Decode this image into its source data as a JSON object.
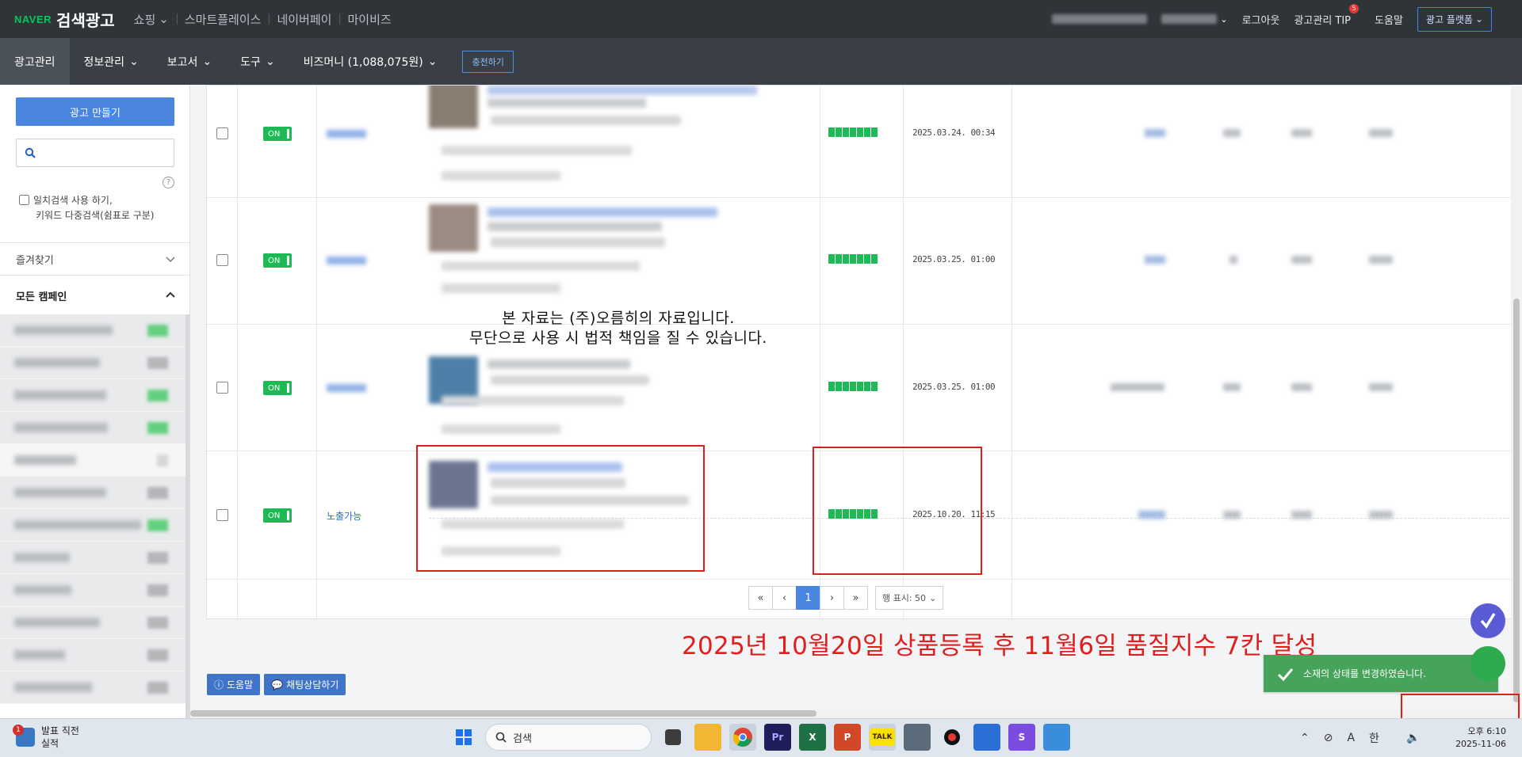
{
  "topbar": {
    "brand_naver": "NAVER",
    "brand_title": "검색광고",
    "nav": [
      "쇼핑",
      "스마트플레이스",
      "네이버페이",
      "마이비즈"
    ],
    "logout": "로그아웃",
    "tip": "광고관리 TIP",
    "tip_badge": "5",
    "help": "도움말",
    "platform": "광고 플랫폼"
  },
  "subbar": {
    "items": [
      "광고관리",
      "정보관리",
      "보고서",
      "도구",
      "비즈머니 (1,088,075원)"
    ],
    "charge": "충전하기"
  },
  "sidebar": {
    "create_button": "광고 만들기",
    "search_placeholder": "",
    "help_mark": "?",
    "exact_line1": "일치검색 사용 하기,",
    "exact_line2": "키워드 다중검색(쉼표로 구분)",
    "favorites": "즐겨찾기",
    "all_campaigns": "모든 캠페인"
  },
  "table": {
    "toggle_label": "ON",
    "rows": [
      {
        "date": "2025.03.24. 00:34",
        "status": ""
      },
      {
        "date": "2025.03.25. 01:00",
        "status": ""
      },
      {
        "date": "2025.03.25. 01:00",
        "status": ""
      },
      {
        "date": "2025.10.20. 11:15",
        "status": "노출가능"
      }
    ],
    "quality_bars_filled": 7
  },
  "watermark": {
    "line1": "본 자료는 (주)오름히의 자료입니다.",
    "line2": "무단으로 사용 시 법적 책임을 질 수 있습니다."
  },
  "pager": {
    "first": "«",
    "prev": "‹",
    "current": "1",
    "next": "›",
    "last": "»",
    "rows_label": "행 표시: 50"
  },
  "caption": "2025년 10월20일 상품등록 후 11월6일 품질지수 7칸 달성",
  "bottom_buttons": {
    "help": "도움말",
    "chat": "채팅상담하기"
  },
  "toast": {
    "message": "소재의 상태를 변경하였습니다."
  },
  "taskbar": {
    "weather_title": "발표 직전",
    "weather_sub": "실적",
    "weather_badge": "1",
    "search_label": "검색",
    "tray_a": "A",
    "tray_han": "한",
    "clock_time": "오후 6:10",
    "clock_date": "2025-11-06"
  },
  "colors": {
    "accent_blue": "#4a85e0",
    "on_green": "#1db954",
    "highlight_red": "#e01e1e",
    "toast_green": "#46a35a"
  }
}
